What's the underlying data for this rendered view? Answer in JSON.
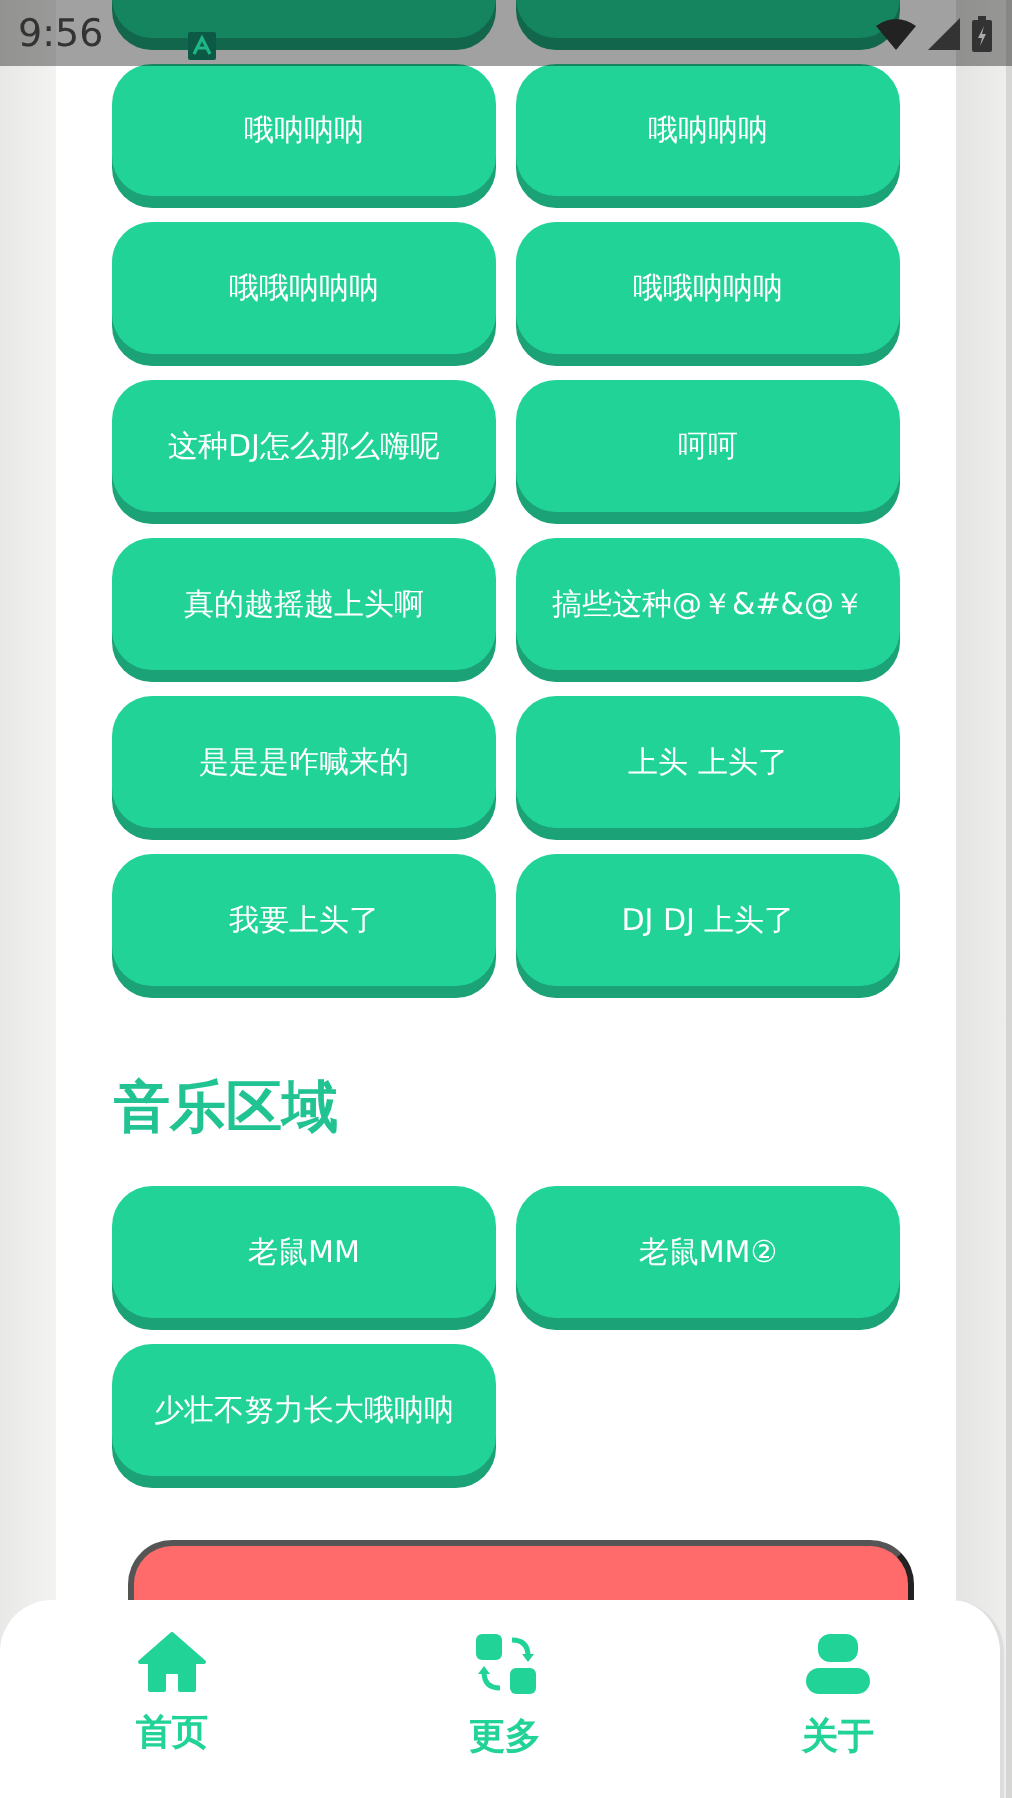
{
  "status_bar": {
    "time": "9:56"
  },
  "sound_buttons": [
    {
      "kind": "cut"
    },
    {
      "kind": "cut"
    },
    {
      "kind": "sound",
      "label": "哦呐呐呐"
    },
    {
      "kind": "sound",
      "label": "哦呐呐呐"
    },
    {
      "kind": "sound",
      "label": "哦哦呐呐呐"
    },
    {
      "kind": "sound",
      "label": "哦哦呐呐呐"
    },
    {
      "kind": "sound",
      "label": "这种DJ怎么那么嗨呢"
    },
    {
      "kind": "sound",
      "label": "呵呵"
    },
    {
      "kind": "sound",
      "label": "真的越摇越上头啊"
    },
    {
      "kind": "sound",
      "label": "搞些这种@￥&#&@￥"
    },
    {
      "kind": "sound",
      "label": "是是是咋喊来的"
    },
    {
      "kind": "sound",
      "label": "上头 上头了"
    },
    {
      "kind": "sound",
      "label": "我要上头了"
    },
    {
      "kind": "sound",
      "label": "DJ DJ 上头了"
    }
  ],
  "music_section": {
    "title": "音乐区域",
    "buttons": [
      {
        "label": "老鼠MM"
      },
      {
        "label": "老鼠MM②"
      },
      {
        "label": "少壮不努力长大哦呐呐"
      }
    ]
  },
  "stop_button": {
    "kind": "cut"
  },
  "bottom_nav": [
    {
      "kind": "home",
      "label": "首页"
    },
    {
      "kind": "swap",
      "label": "更多"
    },
    {
      "kind": "person",
      "label": "关于"
    }
  ]
}
